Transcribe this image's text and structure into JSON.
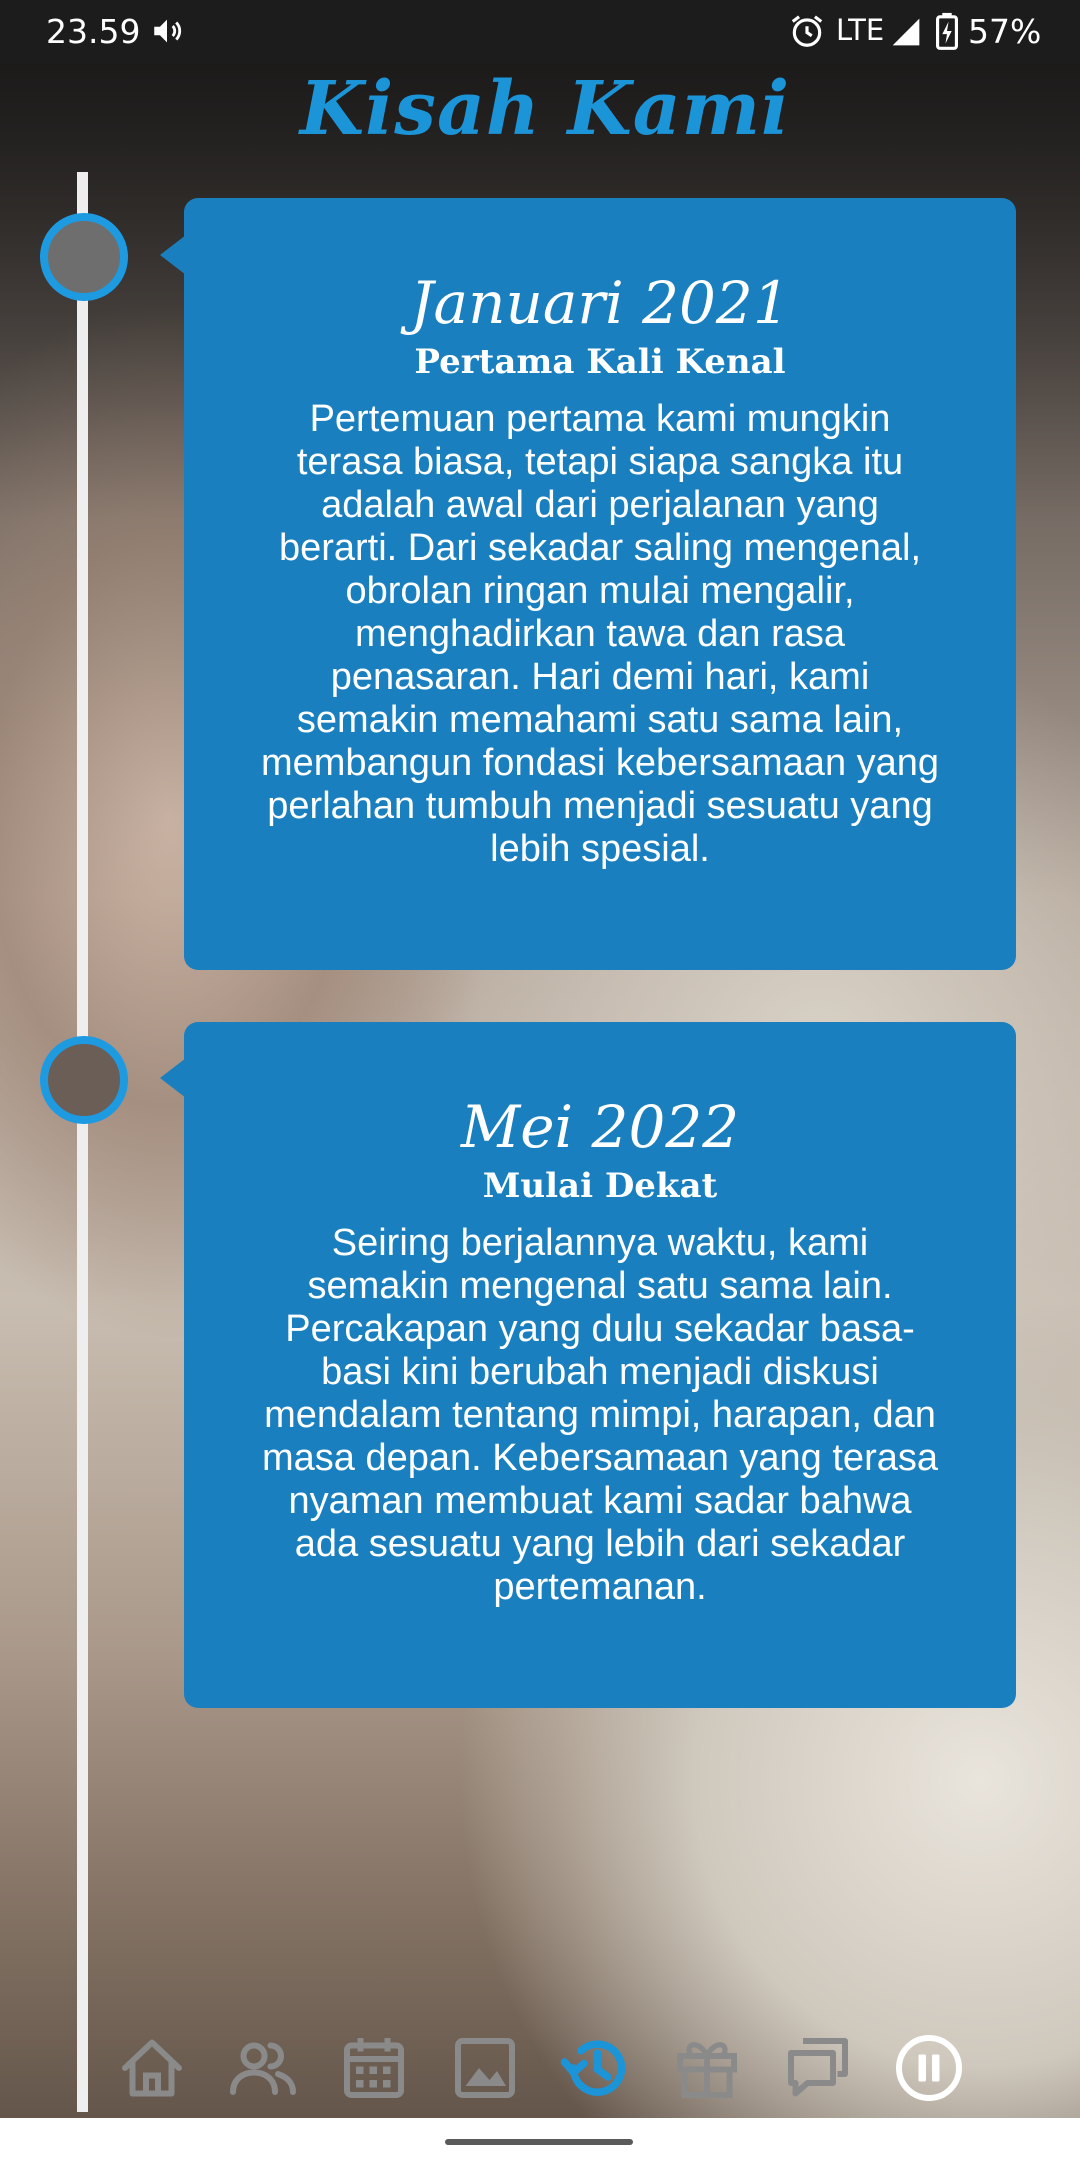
{
  "status_bar": {
    "time": "23.59",
    "network": "LTE",
    "battery": "57%"
  },
  "page": {
    "title": "Kisah Kami"
  },
  "timeline": [
    {
      "date": "Januari 2021",
      "heading": "Pertama Kali Kenal",
      "body": "Pertemuan pertama kami mungkin terasa biasa, tetapi siapa sangka itu adalah awal dari perjalanan yang berarti. Dari sekadar saling mengenal, obrolan ringan mulai mengalir, menghadirkan tawa dan rasa penasaran. Hari demi hari, kami semakin memahami satu sama lain, membangun fondasi kebersamaan yang perlahan tumbuh menjadi sesuatu yang lebih spesial."
    },
    {
      "date": "Mei 2022",
      "heading": "Mulai Dekat",
      "body": "Seiring berjalannya waktu, kami semakin mengenal satu sama lain. Percakapan yang dulu sekadar basa-basi kini berubah menjadi diskusi mendalam tentang mimpi, harapan, dan masa depan. Kebersamaan yang terasa nyaman membuat kami sadar bahwa ada sesuatu yang lebih dari sekadar pertemanan."
    }
  ],
  "bottom_nav": {
    "items": [
      "home-icon",
      "people-icon",
      "calendar-icon",
      "gallery-icon",
      "history-icon",
      "gift-icon",
      "chat-icon",
      "pause-icon"
    ],
    "active": "history-icon"
  },
  "colors": {
    "accent": "#1b94d8",
    "card": "#1a7fbf",
    "nav_inactive": "#8a8a8a",
    "timeline_line": "#eeeeee"
  }
}
